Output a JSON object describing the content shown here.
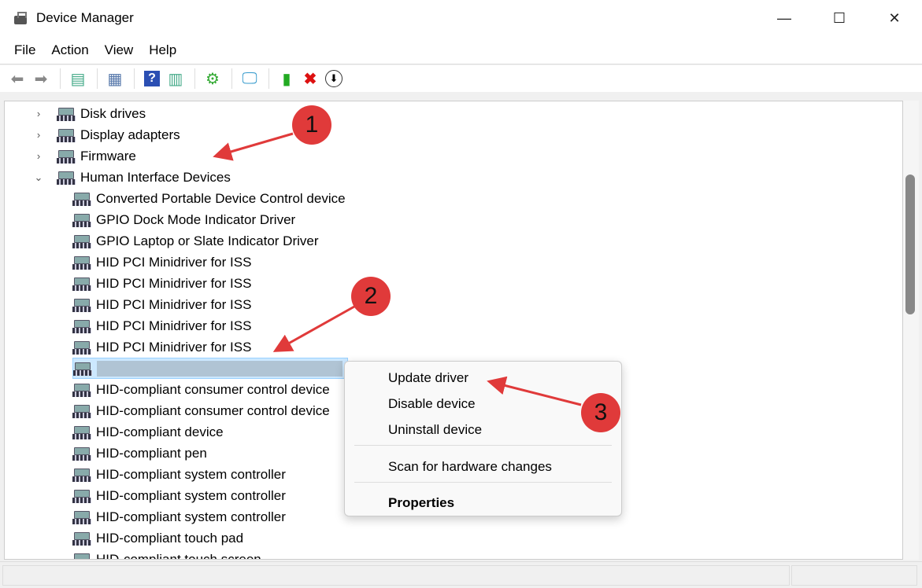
{
  "window": {
    "title": "Device Manager",
    "minimize": "—",
    "maximize": "☐",
    "close": "✕"
  },
  "menu": [
    "File",
    "Action",
    "View",
    "Help"
  ],
  "toolbar": [
    "back-icon",
    "forward-icon",
    "show-hide-console-tree-icon",
    "properties-icon",
    "help-icon",
    "action-pane-icon",
    "update-driver-icon",
    "scan-hardware-icon",
    "enable-device-icon",
    "uninstall-icon",
    "disable-device-icon"
  ],
  "tree": [
    {
      "label": "Disk drives",
      "chevron": "›",
      "level": 0
    },
    {
      "label": "Display adapters",
      "chevron": "›",
      "level": 0
    },
    {
      "label": "Firmware",
      "chevron": "›",
      "level": 0
    },
    {
      "label": "Human Interface Devices",
      "chevron": "⌄",
      "level": 0
    },
    {
      "label": "Converted Portable Device Control device",
      "level": 1
    },
    {
      "label": "GPIO Dock Mode Indicator Driver",
      "level": 1
    },
    {
      "label": "GPIO Laptop or Slate Indicator Driver",
      "level": 1
    },
    {
      "label": "HID PCI Minidriver for ISS",
      "level": 1
    },
    {
      "label": "HID PCI Minidriver for ISS",
      "level": 1
    },
    {
      "label": "HID PCI Minidriver for ISS",
      "level": 1
    },
    {
      "label": "HID PCI Minidriver for ISS",
      "level": 1
    },
    {
      "label": "HID PCI Minidriver for ISS",
      "level": 1
    },
    {
      "label": "",
      "level": 1,
      "selected": true
    },
    {
      "label": "HID-compliant consumer control device",
      "level": 1
    },
    {
      "label": "HID-compliant consumer control device",
      "level": 1
    },
    {
      "label": "HID-compliant device",
      "level": 1
    },
    {
      "label": "HID-compliant pen",
      "level": 1
    },
    {
      "label": "HID-compliant system controller",
      "level": 1
    },
    {
      "label": "HID-compliant system controller",
      "level": 1
    },
    {
      "label": "HID-compliant system controller",
      "level": 1
    },
    {
      "label": "HID-compliant touch pad",
      "level": 1
    },
    {
      "label": "HID-compliant touch screen",
      "level": 1
    }
  ],
  "context_menu": {
    "update": "Update driver",
    "disable": "Disable device",
    "uninstall": "Uninstall device",
    "scan": "Scan for hardware changes",
    "properties": "Properties"
  },
  "annotations": [
    "1",
    "2",
    "3"
  ],
  "colors": {
    "annotation": "#e03a3a",
    "selection": "#cce8ff"
  }
}
